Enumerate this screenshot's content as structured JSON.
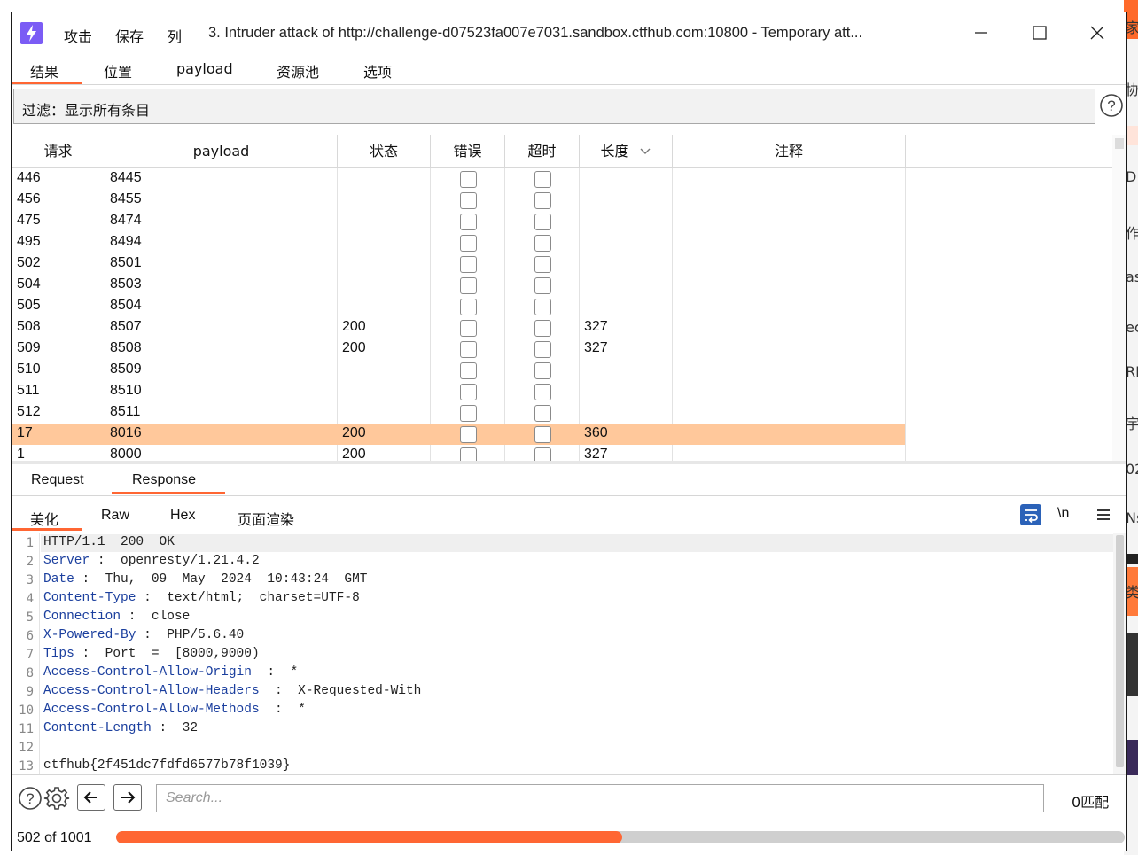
{
  "background_strip": {
    "chars": [
      "家",
      "协",
      "D",
      "作",
      "as",
      "ec",
      "RI",
      "宇",
      "02",
      "Ns",
      "类"
    ]
  },
  "titlebar": {
    "menu": [
      "攻击",
      "保存",
      "列"
    ],
    "title": "3. Intruder attack of http://challenge-d07523fa007e7031.sandbox.ctfhub.com:10800 - Temporary att..."
  },
  "tabs": [
    "结果",
    "位置",
    "payload",
    "资源池",
    "选项"
  ],
  "active_tab": "结果",
  "filter": {
    "text": "过滤：显示所有条目"
  },
  "table": {
    "columns": [
      "请求",
      "payload",
      "状态",
      "错误",
      "超时",
      "长度",
      "注释"
    ],
    "sort_column": "长度",
    "rows": [
      {
        "request": "446",
        "payload": "8445",
        "status": "",
        "length": "",
        "selected": false
      },
      {
        "request": "456",
        "payload": "8455",
        "status": "",
        "length": "",
        "selected": false
      },
      {
        "request": "475",
        "payload": "8474",
        "status": "",
        "length": "",
        "selected": false
      },
      {
        "request": "495",
        "payload": "8494",
        "status": "",
        "length": "",
        "selected": false
      },
      {
        "request": "502",
        "payload": "8501",
        "status": "",
        "length": "",
        "selected": false
      },
      {
        "request": "504",
        "payload": "8503",
        "status": "",
        "length": "",
        "selected": false
      },
      {
        "request": "505",
        "payload": "8504",
        "status": "",
        "length": "",
        "selected": false
      },
      {
        "request": "508",
        "payload": "8507",
        "status": "200",
        "length": "327",
        "selected": false
      },
      {
        "request": "509",
        "payload": "8508",
        "status": "200",
        "length": "327",
        "selected": false
      },
      {
        "request": "510",
        "payload": "8509",
        "status": "",
        "length": "",
        "selected": false
      },
      {
        "request": "511",
        "payload": "8510",
        "status": "",
        "length": "",
        "selected": false
      },
      {
        "request": "512",
        "payload": "8511",
        "status": "",
        "length": "",
        "selected": false
      },
      {
        "request": "17",
        "payload": "8016",
        "status": "200",
        "length": "360",
        "selected": true
      },
      {
        "request": "1",
        "payload": "8000",
        "status": "200",
        "length": "327",
        "selected": false
      }
    ]
  },
  "req_resp_tabs": [
    "Request",
    "Response"
  ],
  "active_req_resp": "Response",
  "view_tabs": [
    "美化",
    "Raw",
    "Hex",
    "页面渲染"
  ],
  "active_view": "美化",
  "newline_label": "\\n",
  "response_lines": [
    {
      "n": "1",
      "key": "",
      "sep": "",
      "val": "HTTP/1.1  200  OK"
    },
    {
      "n": "2",
      "key": "Server",
      "sep": " :  ",
      "val": "openresty/1.21.4.2"
    },
    {
      "n": "3",
      "key": "Date",
      "sep": " :  ",
      "val": "Thu,  09  May  2024  10:43:24  GMT"
    },
    {
      "n": "4",
      "key": "Content-Type",
      "sep": " :  ",
      "val": "text/html;  charset=UTF-8"
    },
    {
      "n": "5",
      "key": "Connection",
      "sep": " :  ",
      "val": "close"
    },
    {
      "n": "6",
      "key": "X-Powered-By",
      "sep": " :  ",
      "val": "PHP/5.6.40"
    },
    {
      "n": "7",
      "key": "Tips",
      "sep": " :  ",
      "val": "Port  =  [8000,9000)"
    },
    {
      "n": "8",
      "key": "Access-Control-Allow-Origin",
      "sep": "  :  ",
      "val": "*"
    },
    {
      "n": "9",
      "key": "Access-Control-Allow-Headers",
      "sep": "  :  ",
      "val": "X-Requested-With"
    },
    {
      "n": "10",
      "key": "Access-Control-Allow-Methods",
      "sep": "  :  ",
      "val": "*"
    },
    {
      "n": "11",
      "key": "Content-Length",
      "sep": " :  ",
      "val": "32"
    },
    {
      "n": "12",
      "key": "",
      "sep": "",
      "val": ""
    },
    {
      "n": "13",
      "key": "",
      "sep": "",
      "val": "ctfhub{2f451dc7fdfd6577b78f1039}"
    }
  ],
  "search": {
    "placeholder": "Search...",
    "matches": "0匹配"
  },
  "progress": {
    "text": "502 of 1001",
    "fraction": 0.5015
  },
  "colors": {
    "accent": "#ff6633",
    "selected_row": "#ffc89b",
    "header_key": "#1b3f9e",
    "app_icon": "#7b5cf5"
  }
}
